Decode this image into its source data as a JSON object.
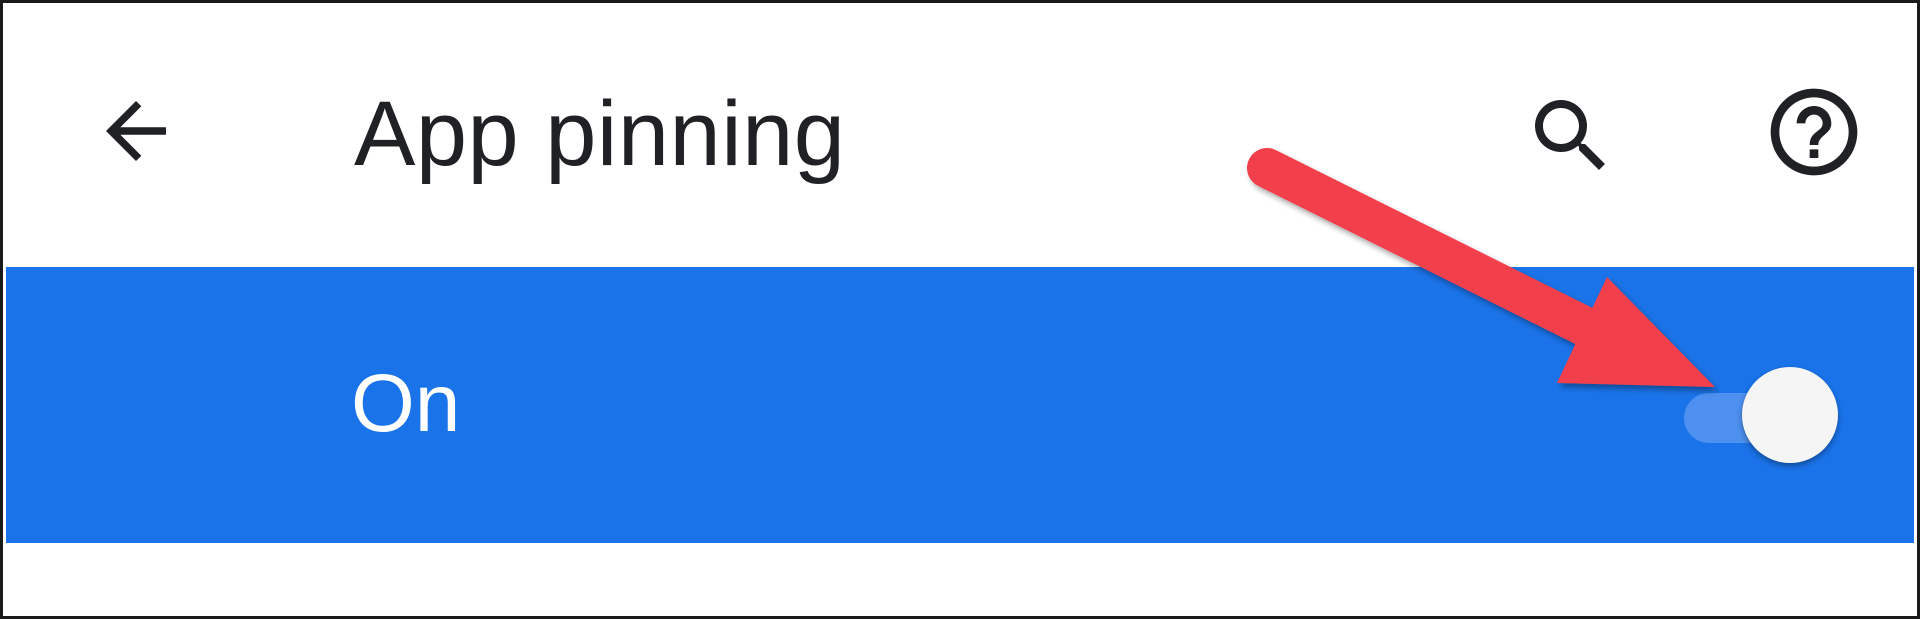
{
  "appbar": {
    "title": "App pinning",
    "back_icon": "arrow-back-icon",
    "search_icon": "search-icon",
    "help_icon": "help-circle-icon"
  },
  "master_switch": {
    "label": "On",
    "checked": true
  },
  "annotation": {
    "type": "arrow",
    "color": "#f1404b"
  },
  "colors": {
    "accent": "#1a73e8",
    "annotation": "#f1404b"
  }
}
